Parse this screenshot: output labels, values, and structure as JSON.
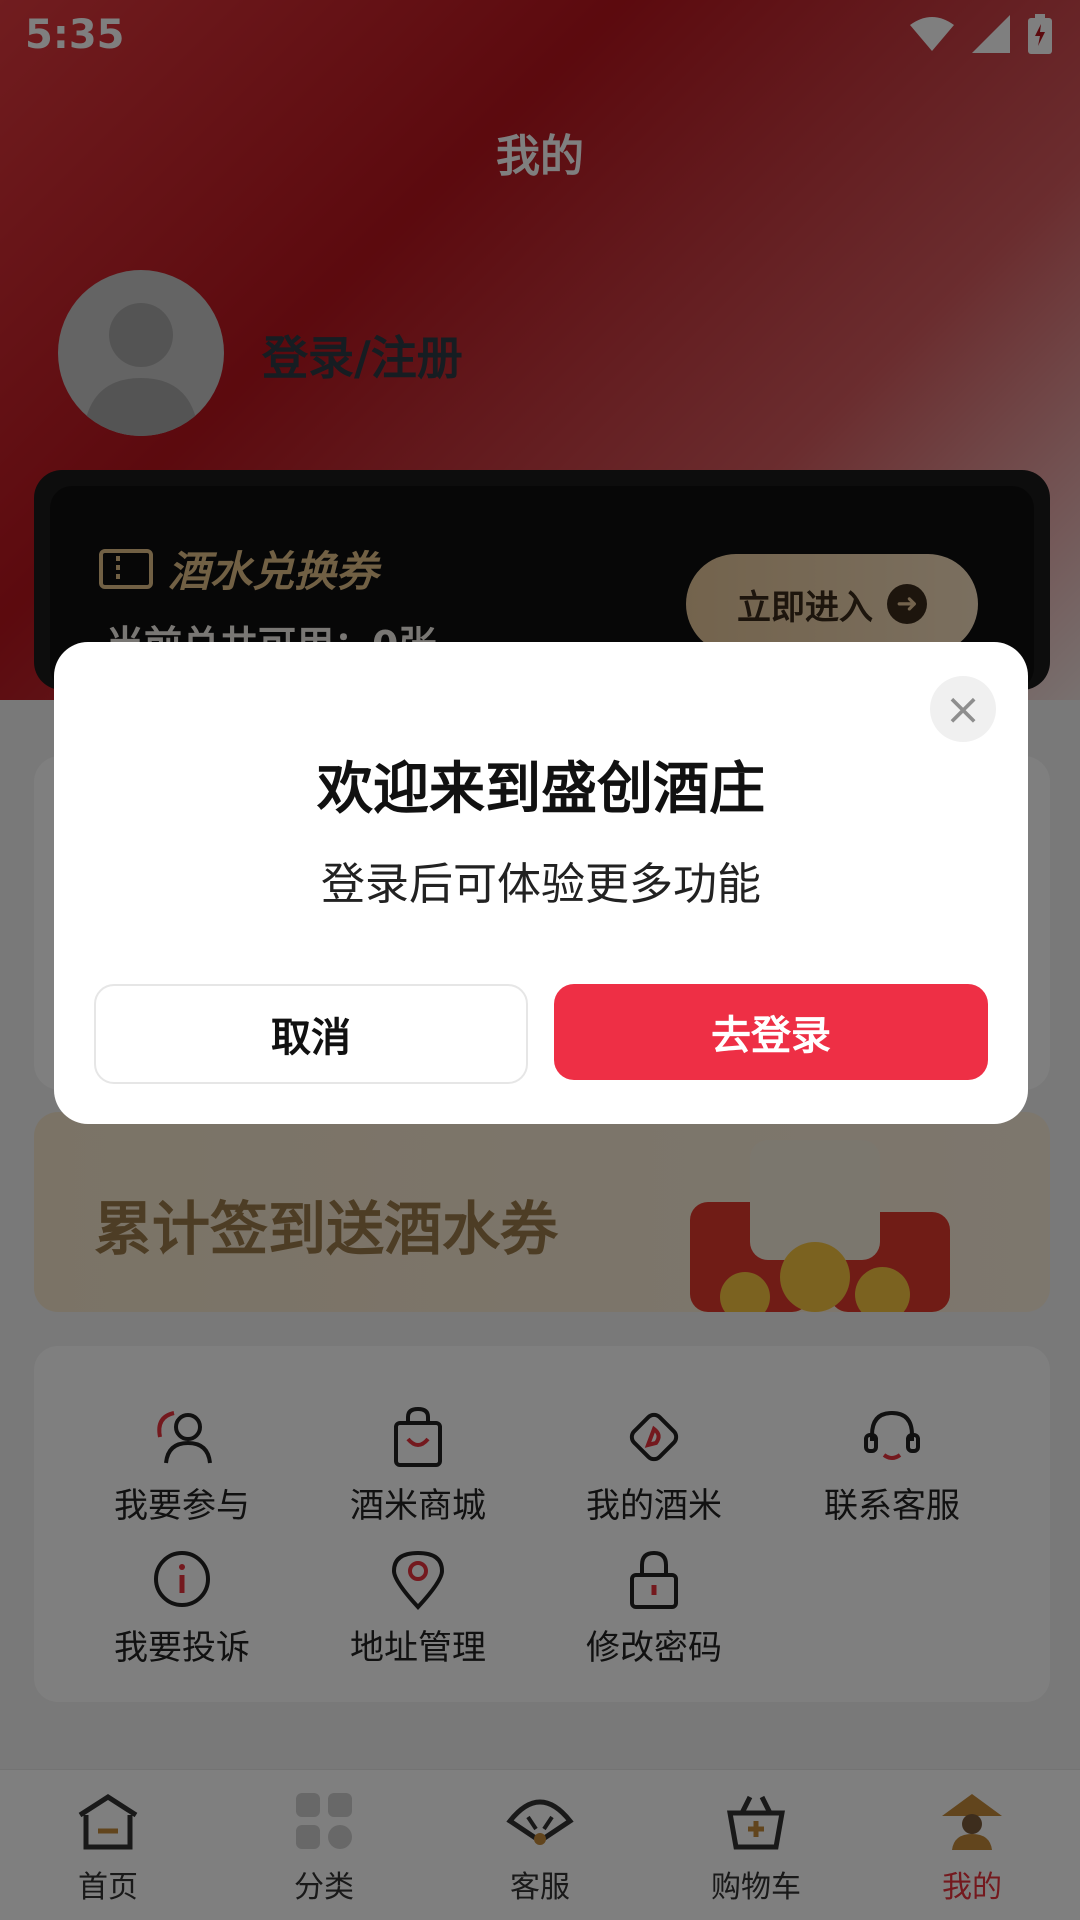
{
  "status_bar": {
    "time": "5:35"
  },
  "header": {
    "title": "我的"
  },
  "profile": {
    "login_text": "登录/注册"
  },
  "voucher": {
    "title": "酒水兑换券",
    "count_text": "当前总共可用：0张",
    "enter_label": "立即进入"
  },
  "banner": {
    "text": "累计签到送酒水券"
  },
  "menu": {
    "items": [
      {
        "label": "我要参与",
        "icon": "participate-icon"
      },
      {
        "label": "酒米商城",
        "icon": "shopping-bag-icon"
      },
      {
        "label": "我的酒米",
        "icon": "rice-token-icon"
      },
      {
        "label": "联系客服",
        "icon": "headset-icon"
      },
      {
        "label": "我要投诉",
        "icon": "info-icon"
      },
      {
        "label": "地址管理",
        "icon": "location-pin-icon"
      },
      {
        "label": "修改密码",
        "icon": "lock-icon"
      }
    ]
  },
  "tabbar": {
    "tabs": [
      {
        "label": "首页",
        "icon": "home-icon"
      },
      {
        "label": "分类",
        "icon": "category-icon"
      },
      {
        "label": "客服",
        "icon": "service-icon"
      },
      {
        "label": "购物车",
        "icon": "cart-icon"
      },
      {
        "label": "我的",
        "icon": "profile-icon",
        "active": true
      }
    ]
  },
  "modal": {
    "title": "欢迎来到盛创酒庄",
    "subtitle": "登录后可体验更多功能",
    "cancel_label": "取消",
    "confirm_label": "去登录"
  },
  "colors": {
    "accent_red": "#ee2f45",
    "header_red": "#b8141d",
    "gold": "#e3c089"
  }
}
